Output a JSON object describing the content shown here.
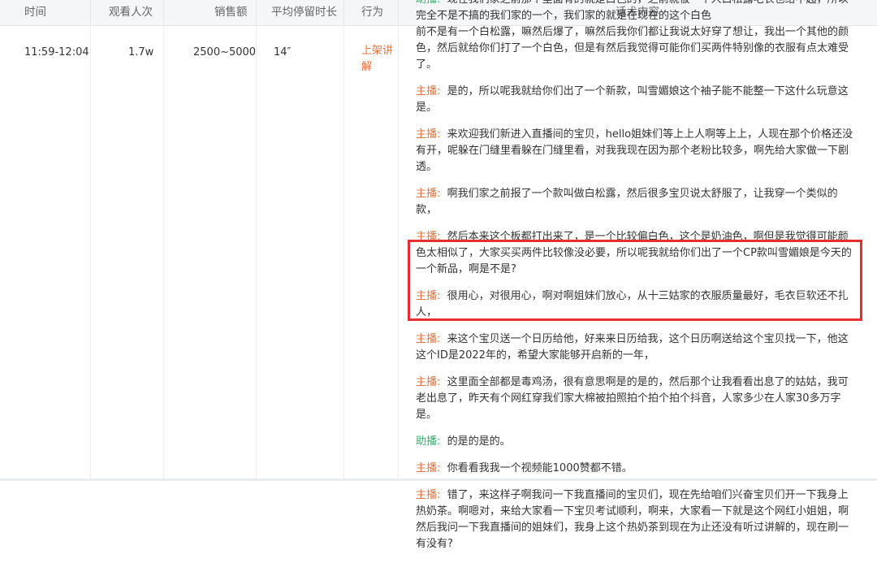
{
  "table": {
    "headers": [
      "时间",
      "观看人次",
      "销售额",
      "平均停留时长",
      "行为",
      "话术内容"
    ],
    "row": {
      "time": "11:59-12:04",
      "viewers": "1.7w",
      "sales": "2500~5000",
      "avg_stay": "14″",
      "action": "上架讲解"
    }
  },
  "speakers": {
    "host": "主播:",
    "assistant": "助播:"
  },
  "script": [
    {
      "speaker": "assistant",
      "text": "现在我们家之前那个里面有的就是白色的，之前就被一个人白松露毛衣也给不起，所以完全不是不搞的我们家的一个，我们家的就是在现在的这个白色"
    },
    {
      "speaker": "none",
      "text": "前不是有一个白松露，嘛然后爆了，嘛然后我你们都让我说太好穿了想让，我出一个其他的颜色，然后就给你们打了一个白色，但是有然后我觉得可能你们买两件特别像的衣服有点太难受了。"
    },
    {
      "speaker": "host",
      "text": "是的，所以呢我就给你们出了一个新款，叫雪媚娘这个袖子能不能整一下这什么玩意这是。"
    },
    {
      "speaker": "host",
      "text": "来欢迎我们新进入直播间的宝贝，hello姐妹们等上上人啊等上上，人现在那个价格还没有开，呢躲在门缝里看躲在门缝里看，对我我现在因为那个老粉比较多，啊先给大家做一下剧透。"
    },
    {
      "speaker": "host",
      "text": "啊我们家之前报了一个款叫做白松露，然后很多宝贝说太舒服了，让我穿一个类似的款，"
    },
    {
      "speaker": "host",
      "text": "然后本来这个板都打出来了，是一个比较偏白色，这个是奶油色，啊但是我觉得可能颜色太相似了，大家买买两件比较像没必要，所以呢我就给你们出了一个CP款叫雪媚娘是今天的一个新品，啊是不是?"
    },
    {
      "speaker": "host",
      "text": "很用心，对很用心，啊对啊姐妹们放心，从十三姑家的衣服质量最好，毛衣巨软还不扎人，"
    },
    {
      "speaker": "host",
      "text": "来这个宝贝送一个日历给他，好来来日历给我，这个日历啊送给这个宝贝找一下，他这这个ID是2022年的，希望大家能够开启新的一年，"
    },
    {
      "speaker": "host",
      "text": "这里面全部都是毒鸡汤，很有意思啊是的是的，然后那个让我看看出息了的姑姑，我可老出息了，昨天有个网红穿我们家大棉被拍照拍个拍个拍个抖音，人家多少在人家30多万字是。"
    },
    {
      "speaker": "assistant",
      "text": "的是的是的。"
    },
    {
      "speaker": "host",
      "text": "你看看我我一个视频能1000赞都不错。"
    },
    {
      "speaker": "host",
      "text": "错了，来这样子啊我问一下我直播间的宝贝们，现在先给咱们兴奋宝贝们开一下我身上热奶茶。啊嗯对，来给大家看一下宝贝考试顺利，啊来，大家看一下就是这个网红小姐姐，啊然后我问一下我直播间的姐妹们，我身上这个热奶茶到现在为止还没有听过讲解的，现在刷一有没有?"
    }
  ]
}
